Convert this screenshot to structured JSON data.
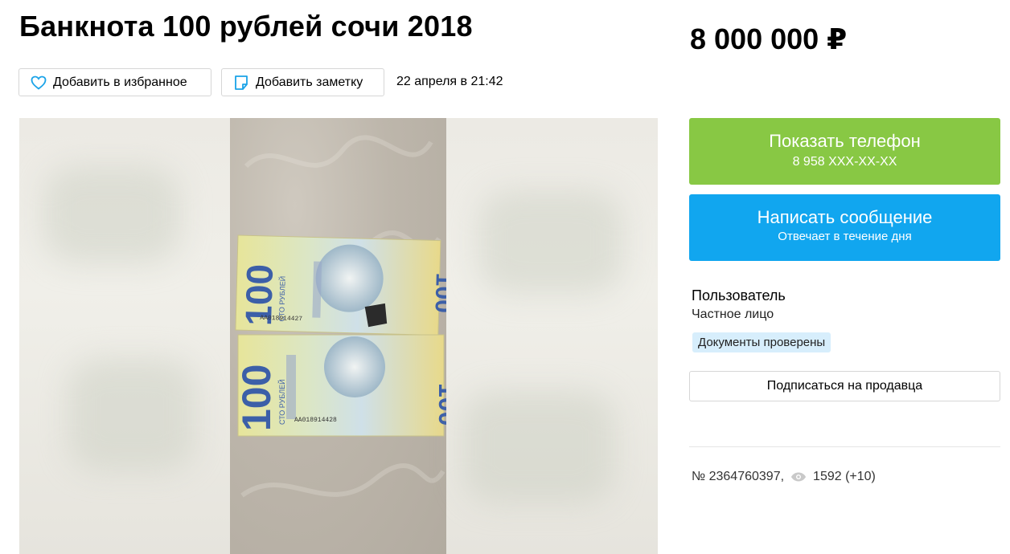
{
  "listing": {
    "title": "Банкнота 100 рублей сочи 2018",
    "price": "8 000 000 ₽",
    "date": "22 апреля в 21:42"
  },
  "actions": {
    "favorite_label": "Добавить в избранное",
    "note_label": "Добавить заметку",
    "favorite_icon": "heart-icon",
    "note_icon": "note-icon"
  },
  "contact": {
    "phone_button_label": "Показать телефон",
    "phone_masked": "8 958 XXX-XX-XX",
    "message_button_label": "Написать сообщение",
    "message_button_sub": "Отвечает в течение дня"
  },
  "seller": {
    "name": "Пользователь",
    "type": "Частное лицо",
    "badge": "Документы проверены",
    "subscribe_label": "Подписаться на продавца"
  },
  "meta": {
    "ad_number": "№ 2364760397,",
    "views": "1592 (+10)",
    "views_icon": "eye-icon"
  },
  "banknotes": [
    {
      "denomination": "100",
      "words": "СТО РУБЛЕЙ",
      "serial": "АА018914427"
    },
    {
      "denomination": "100",
      "words": "СТО РУБЛЕЙ",
      "serial": "АА018914428"
    }
  ],
  "colors": {
    "green": "#88c844",
    "blue": "#11a6ef",
    "badge_bg": "#d7eefc",
    "note_icon": "#1aa3e8",
    "heart_icon": "#1aa3e8"
  }
}
